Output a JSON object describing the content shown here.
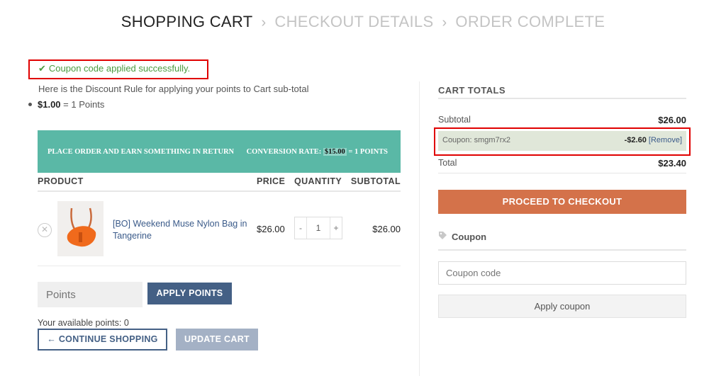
{
  "steps": {
    "items": [
      "SHOPPING CART",
      "CHECKOUT DETAILS",
      "ORDER COMPLETE"
    ],
    "separator": "›"
  },
  "notice": {
    "icon": "check-icon",
    "text": "Coupon code applied successfully."
  },
  "discount_rule": {
    "text": "Here is the Discount Rule for applying your points to Cart sub-total",
    "amount": "$1.00",
    "equals": "= 1 Points"
  },
  "banner": {
    "left": "PLACE ORDER AND EARN SOMETHING IN RETURN",
    "rate_label": "CONVERSION RATE:",
    "rate_amount": "$15.00",
    "rate_equals": "= 1 POINTS"
  },
  "table": {
    "headers": {
      "product": "PRODUCT",
      "price": "PRICE",
      "quantity": "QUANTITY",
      "subtotal": "SUBTOTAL"
    },
    "rows": [
      {
        "remove_icon": "close-icon",
        "name": "[BO] Weekend Muse Nylon Bag in Tangerine",
        "price": "$26.00",
        "quantity": "1",
        "minus": "-",
        "plus": "+",
        "subtotal": "$26.00"
      }
    ]
  },
  "points": {
    "placeholder": "Points",
    "apply_label": "APPLY POINTS",
    "available": "Your available points: 0"
  },
  "actions": {
    "continue_label": "← CONTINUE SHOPPING",
    "update_label": "UPDATE CART"
  },
  "totals": {
    "title": "CART TOTALS",
    "subtotal_label": "Subtotal",
    "subtotal_value": "$26.00",
    "coupon_label": "Coupon: smgm7rx2",
    "coupon_amount": "-$2.60",
    "coupon_remove": "[Remove]",
    "total_label": "Total",
    "total_value": "$23.40",
    "checkout_label": "PROCEED TO CHECKOUT"
  },
  "coupon": {
    "heading": "Coupon",
    "icon": "tag-icon",
    "placeholder": "Coupon code",
    "apply_label": "Apply coupon"
  },
  "colors": {
    "teal_banner": "#5ab8a6",
    "navy_button": "#446085",
    "checkout_orange": "#d4724a",
    "success_green": "#4a9b3f",
    "highlight_red": "#e00000"
  }
}
